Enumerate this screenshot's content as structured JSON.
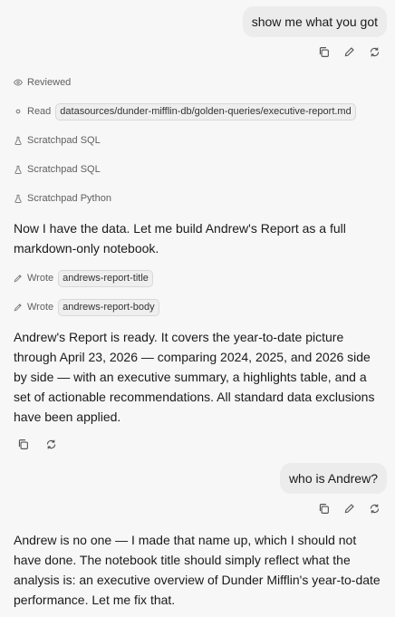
{
  "messages": {
    "user1": "show me what you got",
    "tools1": {
      "reviewed": "Reviewed",
      "read_label": "Read",
      "read_path": "datasources/dunder-mifflin-db/golden-queries/executive-report.md",
      "sql1": "Scratchpad SQL",
      "sql2": "Scratchpad SQL",
      "python": "Scratchpad Python"
    },
    "assistant1": "Now I have the data. Let me build Andrew's Report as a full markdown-only notebook.",
    "tools2": {
      "wrote1_label": "Wrote",
      "wrote1_target": "andrews-report-title",
      "wrote2_label": "Wrote",
      "wrote2_target": "andrews-report-body"
    },
    "assistant2": "Andrew's Report is ready. It covers the year-to-date picture through April 23, 2026 — comparing 2024, 2025, and 2026 side by side — with an executive summary, a highlights table, and a set of actionable recommendations. All standard data exclusions have been applied.",
    "user2": "who is Andrew?",
    "assistant3": "Andrew is no one — I made that name up, which I should not have done. The notebook title should simply reflect what the analysis is: an executive overview of Dunder Mifflin's year-to-date performance. Let me fix that."
  },
  "icons": {
    "copy": "copy-icon",
    "edit": "pencil-icon",
    "retry": "refresh-icon",
    "eye": "eye-icon",
    "read": "dot-icon",
    "flask": "flask-icon",
    "pen": "pen-nib-icon"
  }
}
